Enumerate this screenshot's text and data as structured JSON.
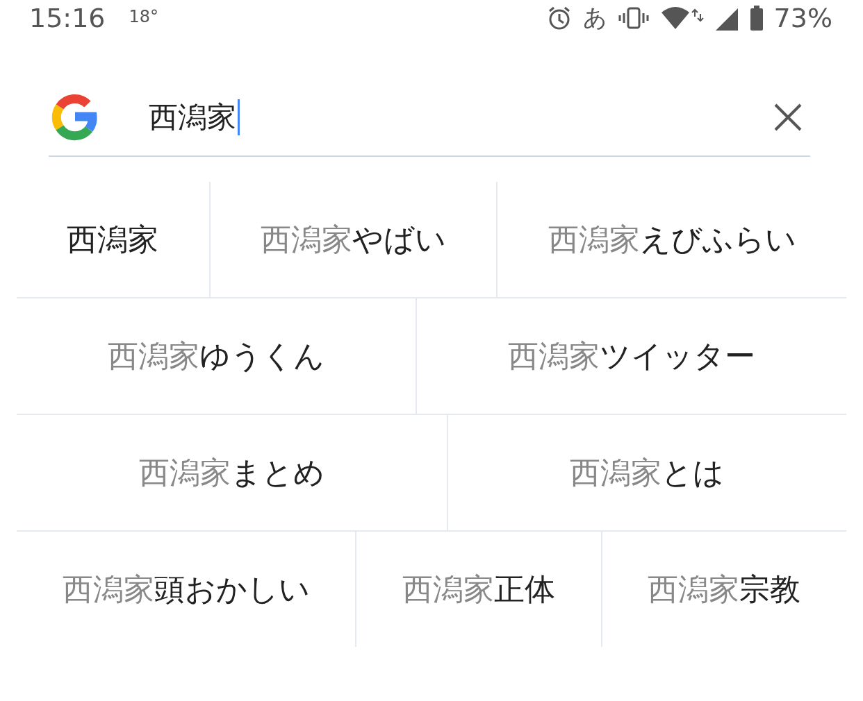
{
  "status_bar": {
    "time": "15:16",
    "temperature": "18°",
    "ime": "あ",
    "battery": "73%"
  },
  "search": {
    "value": "西潟家"
  },
  "suggestion_rows": [
    [
      {
        "text": "西潟家",
        "kind": "exact"
      },
      {
        "text": "西潟家 **やばい**",
        "kind": "completion"
      },
      {
        "text": "西潟家**えびふらい**",
        "kind": "completion"
      }
    ],
    [
      {
        "text": "西潟家 **ゆうくん**",
        "kind": "completion"
      },
      {
        "text": "西潟家 **ツイッター**",
        "kind": "completion"
      }
    ],
    [
      {
        "text": "西潟家 **まとめ**",
        "kind": "completion"
      },
      {
        "text": "西潟家**とは**",
        "kind": "completion"
      }
    ],
    [
      {
        "text": "西潟家 **頭おかしい**",
        "kind": "completion"
      },
      {
        "text": "西潟家 **正体**",
        "kind": "completion"
      },
      {
        "text": "西潟家 **宗教**",
        "kind": "completion"
      }
    ]
  ]
}
